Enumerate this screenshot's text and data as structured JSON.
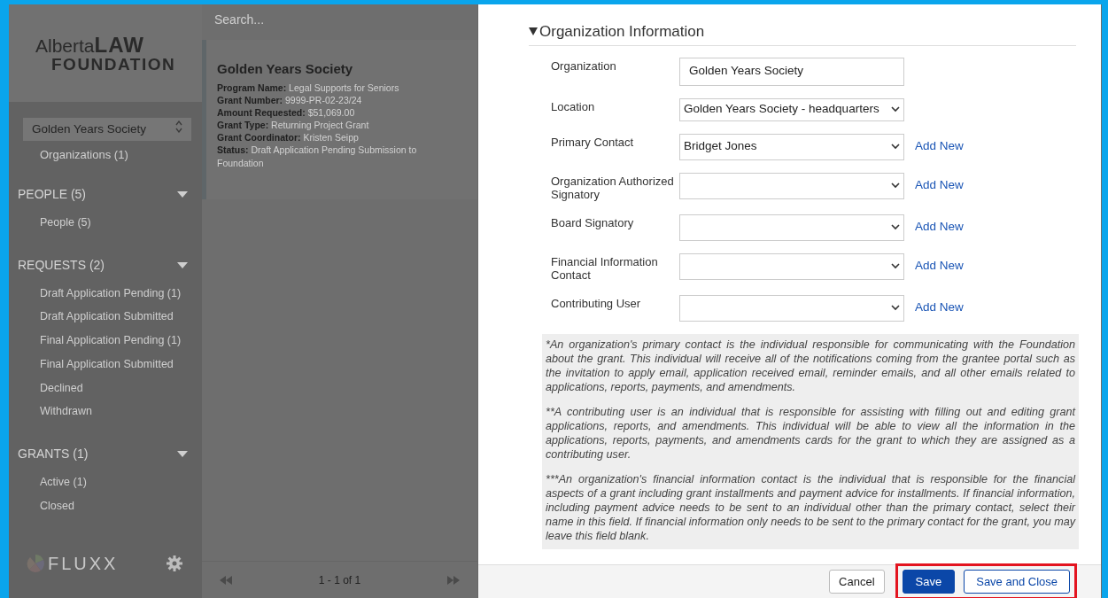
{
  "sidebar": {
    "logo": {
      "line1": "Alberta",
      "line2": "LAW",
      "line3": "FOUNDATION"
    },
    "org_select": "Golden Years Society",
    "org_link": "Organizations (1)",
    "sections": [
      {
        "title": "PEOPLE (5)",
        "expanded": true,
        "items": [
          "People (5)"
        ]
      },
      {
        "title": "REQUESTS (2)",
        "expanded": true,
        "items": [
          "Draft Application Pending (1)",
          "Draft Application Submitted",
          "Final Application Pending (1)",
          "Final Application Submitted",
          "Declined",
          "Withdrawn"
        ]
      },
      {
        "title": "GRANTS (1)",
        "expanded": true,
        "items": [
          "Active (1)",
          "Closed"
        ]
      }
    ],
    "brand": "FLUXX"
  },
  "list": {
    "search": {
      "placeholder": "Search..."
    },
    "cards": [
      {
        "title": "Golden Years Society",
        "fields": [
          {
            "label": "Program Name:",
            "value": "Legal Supports for Seniors"
          },
          {
            "label": "Grant Number:",
            "value": "9999-PR-02-23/24"
          },
          {
            "label": "Amount Requested:",
            "value": "$51,069.00"
          },
          {
            "label": "Grant Type:",
            "value": "Returning Project Grant"
          },
          {
            "label": "Grant Coordinator:",
            "value": "Kristen Seipp"
          },
          {
            "label": "Status:",
            "value": "Draft Application Pending Submission to Foundation"
          }
        ]
      }
    ],
    "pager": "1 - 1 of 1"
  },
  "modal": {
    "section": {
      "title": "Organization Information",
      "expanded": true
    },
    "fields": [
      {
        "label": "Organization",
        "kind": "text",
        "value": "Golden Years Society"
      },
      {
        "label": "Location",
        "kind": "select",
        "value": "Golden Years Society - headquarters"
      },
      {
        "label": "Primary Contact",
        "kind": "select",
        "value": "Bridget Jones",
        "add_new": "Add New"
      },
      {
        "label": "Organization Authorized Signatory",
        "kind": "select",
        "add_new": "Add New"
      },
      {
        "label": "Board Signatory",
        "kind": "select",
        "add_new": "Add New"
      },
      {
        "label": "Financial Information Contact",
        "kind": "select",
        "add_new": "Add New"
      },
      {
        "label": "Contributing User",
        "kind": "select",
        "add_new": "Add New"
      }
    ],
    "notes": [
      "*An organization's primary contact is the individual responsible for communicating with the Foundation about the grant. This individual will receive all of the notifications coming from the grantee portal such as the invitation to apply email, application received email, reminder emails, and all other emails related to applications, reports, payments, and amendments.",
      "**A contributing user is an individual that is responsible for assisting with filling out and editing grant applications, reports, and amendments. This individual will be able to view all the information in the applications, reports, payments, and amendments cards for the grant to which they are assigned as a contributing user.",
      "***An organization's financial information contact is the individual that is responsible for the financial aspects of a grant including grant installments and payment advice for installments. If financial information, including payment advice needs to be sent to an individual other than the primary contact, select their name in this field. If financial information only needs to be sent to the primary contact for the grant, you may leave this field blank."
    ],
    "buttons": [
      {
        "label": "Cancel",
        "kind": "secondary",
        "highlighted": false
      },
      {
        "label": "Save",
        "kind": "primary",
        "highlighted": true
      },
      {
        "label": "Save and Close",
        "kind": "outline",
        "highlighted": true
      }
    ]
  }
}
